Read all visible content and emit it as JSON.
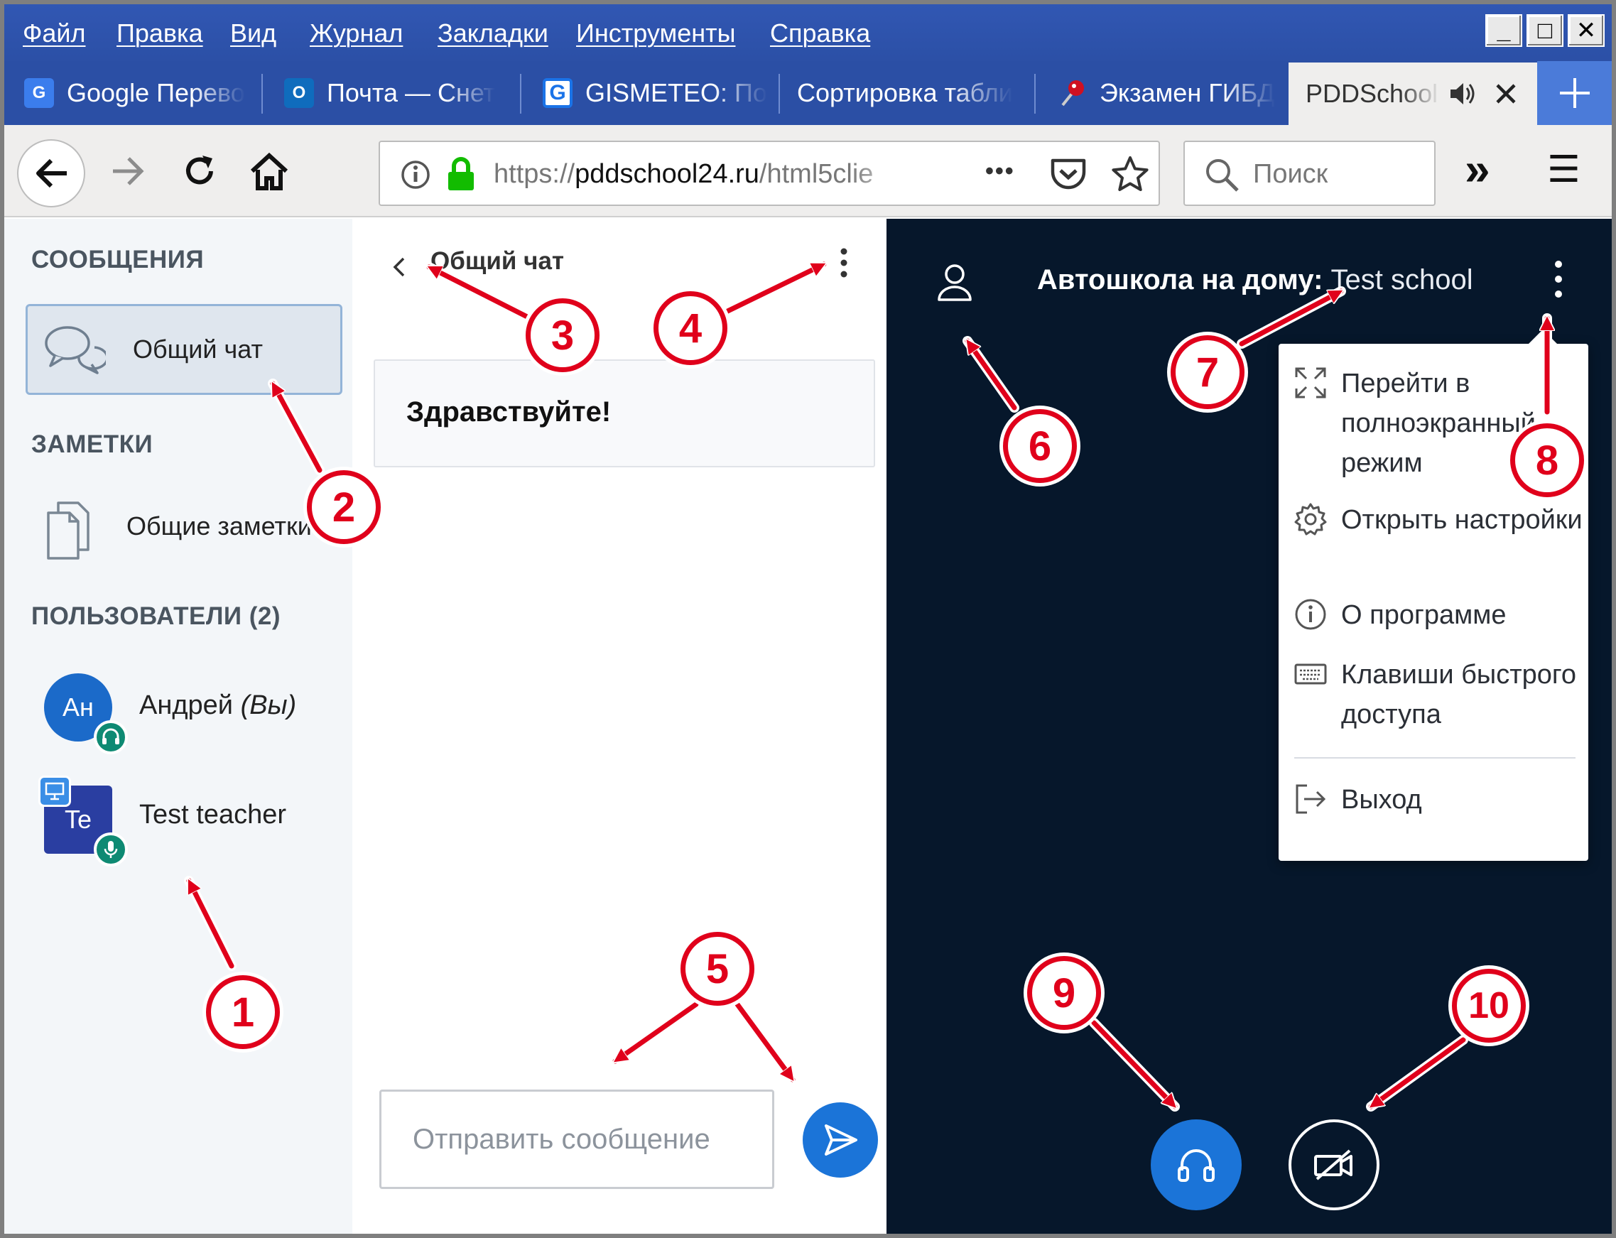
{
  "menubar": {
    "items": [
      "Файл",
      "Правка",
      "Вид",
      "Журнал",
      "Закладки",
      "Инструменты",
      "Справка"
    ],
    "window_buttons": [
      "_",
      "□",
      "✕"
    ]
  },
  "tabs": [
    {
      "label": "Google Перево",
      "icon": "google-translate-icon",
      "color": "#3b7ded"
    },
    {
      "label": "Почта — Снет",
      "icon": "outlook-icon",
      "color": "#0f6cbd"
    },
    {
      "label": "GISMETEO: По",
      "icon": "gismeteo-icon",
      "color": "#1a73e8"
    },
    {
      "label": "Сортировка табли",
      "icon": "",
      "color": ""
    },
    {
      "label": "Экзамен ГИБД",
      "icon": "map-pin-icon",
      "color": "#d01020"
    },
    {
      "label": "PDDSchool",
      "icon": "",
      "color": "",
      "active": true
    }
  ],
  "navbar": {
    "url_prefix": "https://",
    "url_domain": "pddschool24.ru",
    "url_rest": "/html5clie",
    "more_glyph": "•••",
    "search_placeholder": "Поиск",
    "overflow_glyph": "»",
    "menu_glyph": "☰"
  },
  "sidebar": {
    "messages_title": "СООБЩЕНИЯ",
    "chat_item": "Общий чат",
    "notes_title": "ЗАМЕТКИ",
    "notes_item": "Общие заметки",
    "users_title": "ПОЛЬЗОВАТЕЛИ",
    "users_count": "(2)",
    "users": [
      {
        "initials": "Ан",
        "name": "Андрей",
        "suffix": "(Вы)",
        "color": "#1b6ac9"
      },
      {
        "initials": "Te",
        "name": "Test teacher",
        "suffix": "",
        "color": "#2a3ea1"
      }
    ]
  },
  "chat": {
    "header": "Общий чат",
    "messages": [
      "Здравствуйте!"
    ],
    "input_placeholder": "Отправить сообщение"
  },
  "main": {
    "title_prefix": "Автошкола на дому:",
    "title_name": "Test school",
    "menu": [
      {
        "icon": "fullscreen-icon",
        "label": "Перейти в полноэкранный режим"
      },
      {
        "icon": "settings-icon",
        "label": "Открыть настройки"
      },
      {
        "icon": "info-icon",
        "label": "О программе"
      },
      {
        "icon": "keyboard-icon",
        "label": "Клавиши быстрого доступа"
      },
      {
        "icon": "logout-icon",
        "label": "Выход"
      }
    ]
  },
  "annotations": [
    "1",
    "2",
    "3",
    "4",
    "5",
    "6",
    "7",
    "8",
    "9",
    "10"
  ],
  "colors": {
    "accent": "#1b74d8",
    "annotation": "#e0001b",
    "main_bg": "#06172b",
    "chrome_blue": "#2b4fa5"
  }
}
